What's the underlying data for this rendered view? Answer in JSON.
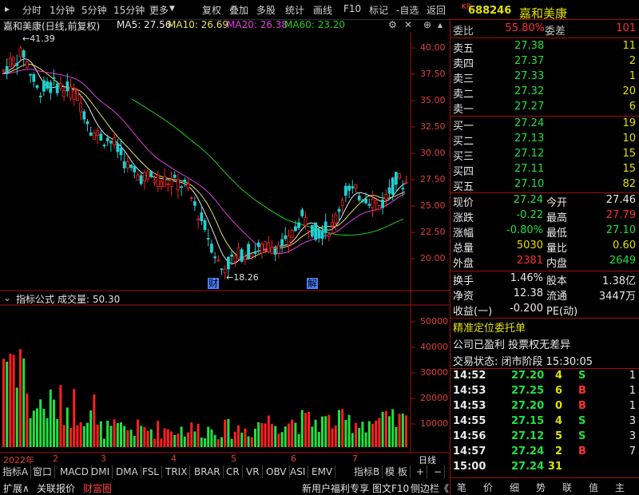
{
  "toolbar": {
    "items": [
      "分时",
      "1分钟",
      "5分钟",
      "15分钟",
      "更多",
      "复权",
      "叠加",
      "多股",
      "统计",
      "画线",
      "F10",
      "标记",
      "-自选",
      "返回"
    ]
  },
  "chart": {
    "title": "嘉和美康(日线,前复权)",
    "ma5_label": "MA5: 27.56",
    "ma10_label": "MA10: 26.69",
    "ma20_label": "MA20: 26.38",
    "ma60_label": "MA60: 23.20",
    "high_marker": "41.39",
    "low_marker": "18.26",
    "marker_cai": "财",
    "marker_jie": "解",
    "price_ticks": [
      "40.00",
      "37.50",
      "35.00",
      "32.50",
      "30.00",
      "27.50",
      "25.00",
      "22.50",
      "20.00"
    ],
    "indicator_label": "指标公式",
    "volume_label": "成交量: 50.30",
    "volume_ticks": [
      "50000",
      "40000",
      "30000",
      "20000",
      "10000"
    ],
    "date_ticks": [
      "2022年",
      "2",
      "3",
      "4",
      "5",
      "6",
      "7"
    ],
    "period_label": "日线",
    "colors": {
      "ma5": "#e8e8e8",
      "ma10": "#e8e060",
      "ma20": "#e040e0",
      "ma60": "#20d020",
      "up": "#ff2020",
      "down": "#20d0d0",
      "vol_up": "#ff2020",
      "vol_down": "#20e040"
    }
  },
  "tabs": {
    "items": [
      "指标A",
      "窗口",
      "MACD",
      "DMI",
      "DMA",
      "FSL",
      "TRIX",
      "BRAR",
      "CR",
      "VR",
      "OBV",
      "ASI",
      "EMV",
      "指标B",
      "模 板",
      "+",
      "−"
    ]
  },
  "status_bar": {
    "items": [
      "扩展∧",
      "关联报价",
      "财富圈",
      "新用户福利专享",
      "图文F10",
      "侧边栏《"
    ]
  },
  "quote": {
    "market_badge": "KR",
    "code": "688246",
    "name": "嘉和美康",
    "weibi_label": "委比",
    "weibi_value": "55.80%",
    "weicha_label": "委差",
    "weicha_value": "101",
    "asks": [
      {
        "label": "卖五",
        "price": "27.38",
        "vol": "11"
      },
      {
        "label": "卖四",
        "price": "27.37",
        "vol": "2"
      },
      {
        "label": "卖三",
        "price": "27.33",
        "vol": "1"
      },
      {
        "label": "卖二",
        "price": "27.32",
        "vol": "20"
      },
      {
        "label": "卖一",
        "price": "27.27",
        "vol": "6"
      }
    ],
    "bids": [
      {
        "label": "买一",
        "price": "27.24",
        "vol": "19"
      },
      {
        "label": "买二",
        "price": "27.13",
        "vol": "10"
      },
      {
        "label": "买三",
        "price": "27.12",
        "vol": "15"
      },
      {
        "label": "买四",
        "price": "27.11",
        "vol": "15"
      },
      {
        "label": "买五",
        "price": "27.10",
        "vol": "82"
      }
    ],
    "stats": [
      {
        "l1": "现价",
        "v1": "27.24",
        "c1": "green",
        "l2": "今开",
        "v2": "27.46",
        "c2": "white"
      },
      {
        "l1": "涨跌",
        "v1": "-0.22",
        "c1": "green",
        "l2": "最高",
        "v2": "27.79",
        "c2": "red"
      },
      {
        "l1": "涨幅",
        "v1": "-0.80%",
        "c1": "green",
        "l2": "最低",
        "v2": "27.10",
        "c2": "green"
      },
      {
        "l1": "总量",
        "v1": "5030",
        "c1": "yellow",
        "l2": "量比",
        "v2": "0.60",
        "c2": "yellow"
      },
      {
        "l1": "外盘",
        "v1": "2381",
        "c1": "red",
        "l2": "内盘",
        "v2": "2649",
        "c2": "green"
      }
    ],
    "stats2": [
      {
        "l1": "换手",
        "v1": "1.46%",
        "l2": "股本",
        "v2": "1.38亿"
      },
      {
        "l1": "净资",
        "v1": "12.38",
        "l2": "流通",
        "v2": "3447万"
      },
      {
        "l1": "收益(一)",
        "v1": "-0.200",
        "l2": "PE(动)",
        "v2": ""
      }
    ],
    "precise_order": "精准定位委托单",
    "info1": "公司已盈利 投票权无差异",
    "trade_state": "交易状态: 闭市阶段 15:30:05",
    "ticks": [
      {
        "t": "14:52",
        "p": "27.20",
        "v": "4",
        "s": "S"
      },
      {
        "t": "14:53",
        "p": "27.25",
        "v": "6",
        "s": "B"
      },
      {
        "t": "14:53",
        "p": "27.20",
        "v": "0",
        "s": "B"
      },
      {
        "t": "14:55",
        "p": "27.15",
        "v": "4",
        "s": "S"
      },
      {
        "t": "14:56",
        "p": "27.12",
        "v": "5",
        "s": "S"
      },
      {
        "t": "14:57",
        "p": "27.24",
        "v": "2",
        "s": "B"
      },
      {
        "t": "15:00",
        "p": "27.24",
        "v": "31",
        "s": ""
      }
    ],
    "tick_counts": [
      "1",
      "1",
      "1",
      "3",
      "3",
      "7",
      ""
    ],
    "bottom_tabs": [
      "笔",
      "价",
      "细",
      "势",
      "联",
      "值",
      "主"
    ]
  }
}
